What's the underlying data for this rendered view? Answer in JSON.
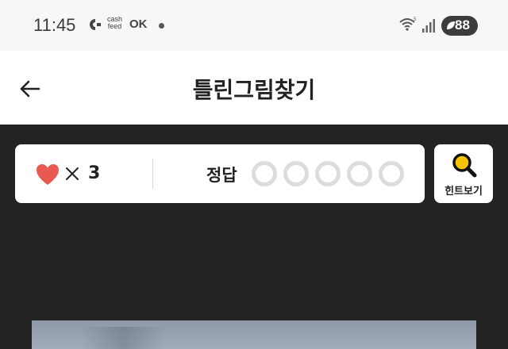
{
  "status_bar": {
    "time": "11:45",
    "cashfeed_line1": "cash",
    "cashfeed_line2": "feed",
    "ok_label": "OK",
    "battery": "88"
  },
  "header": {
    "title": "틀린그림찾기",
    "back_icon": "arrow-left-icon"
  },
  "game": {
    "lives_icon": "heart-icon",
    "lives_color": "#e85a4f",
    "lives_multiplier": "×",
    "lives_count": "3",
    "answer_label": "정답",
    "answers_found": [
      false,
      false,
      false,
      false,
      false
    ],
    "hint": {
      "icon": "magnifier-icon",
      "label": "힌트보기",
      "accent": "#f5c400"
    }
  }
}
